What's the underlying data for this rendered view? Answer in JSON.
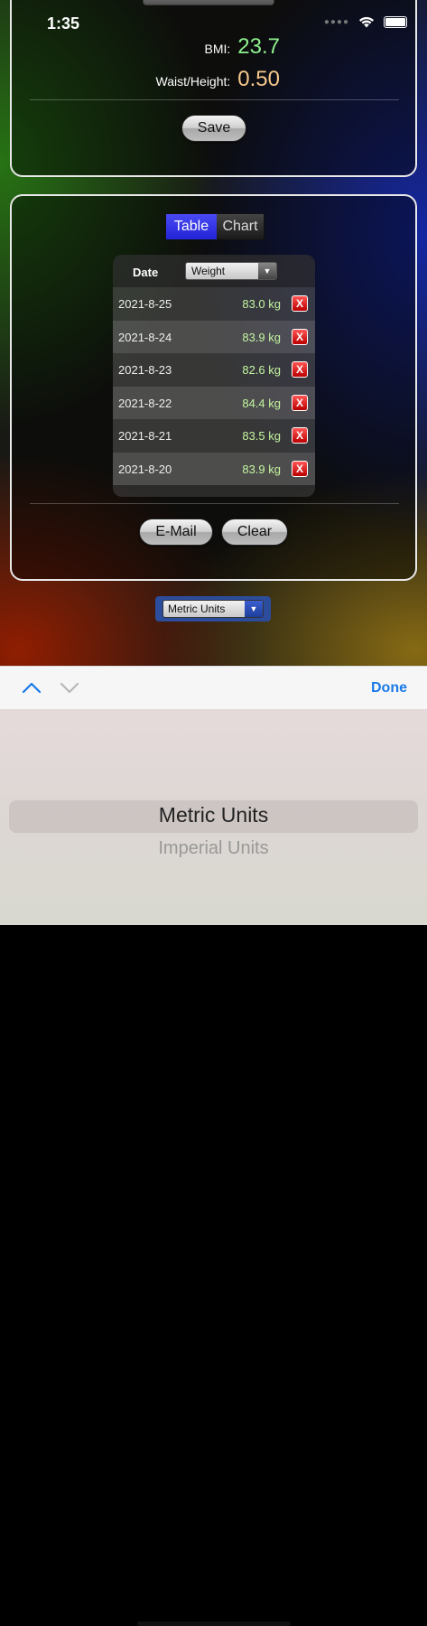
{
  "status_bar": {
    "time": "1:35"
  },
  "summary": {
    "bmi_label": "BMI:",
    "bmi_value": "23.7",
    "waist_label": "Waist/Height:",
    "waist_value": "0.50",
    "save_label": "Save"
  },
  "colors": {
    "bmi": "#8ef08e",
    "waist": "#f5c78a",
    "segment_active": "#3030e0",
    "delete": "#d81818",
    "accent": "#1a7ae8"
  },
  "view_toggle": {
    "table_label": "Table",
    "chart_label": "Chart",
    "selected": "Table"
  },
  "table": {
    "date_header": "Date",
    "metric_select": "Weight",
    "rows": [
      {
        "date": "2021-8-25",
        "value": "83.0 kg"
      },
      {
        "date": "2021-8-24",
        "value": "83.9 kg"
      },
      {
        "date": "2021-8-23",
        "value": "82.6 kg"
      },
      {
        "date": "2021-8-22",
        "value": "84.4 kg"
      },
      {
        "date": "2021-8-21",
        "value": "83.5 kg"
      },
      {
        "date": "2021-8-20",
        "value": "83.9 kg"
      }
    ],
    "delete_glyph": "X"
  },
  "actions": {
    "email_label": "E-Mail",
    "clear_label": "Clear"
  },
  "units": {
    "selected": "Metric Units"
  },
  "keyboard_bar": {
    "done_label": "Done"
  },
  "picker": {
    "selected": "Metric Units",
    "next": "Imperial Units"
  }
}
